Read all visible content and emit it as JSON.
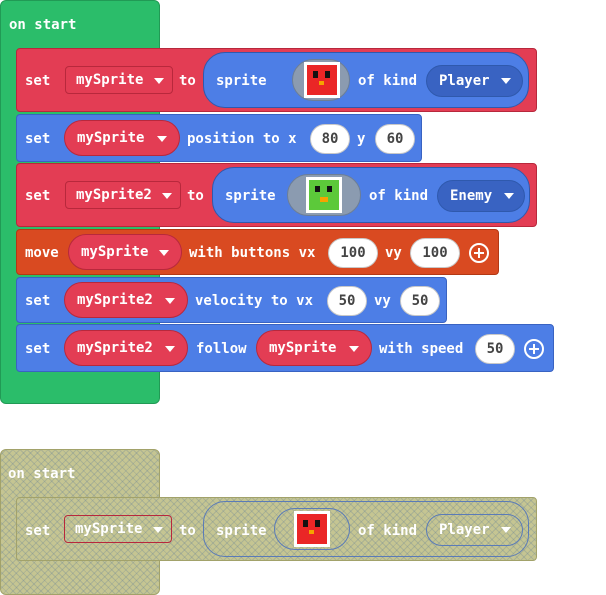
{
  "workspace": {
    "event_label": "on start",
    "blocks": {
      "b1": {
        "set": "set",
        "var": "mySprite",
        "to": "to",
        "sprite": "sprite",
        "of_kind": "of kind",
        "kind": "Player",
        "icon": "red-sprite-icon"
      },
      "b2": {
        "set": "set",
        "var": "mySprite",
        "position_to_x": "position to x",
        "x": "80",
        "y_label": "y",
        "y": "60"
      },
      "b3": {
        "set": "set",
        "var": "mySprite2",
        "to": "to",
        "sprite": "sprite",
        "of_kind": "of kind",
        "kind": "Enemy",
        "icon": "green-sprite-icon"
      },
      "b4": {
        "move": "move",
        "var": "mySprite",
        "with_buttons_vx": "with buttons vx",
        "vx": "100",
        "vy_label": "vy",
        "vy": "100"
      },
      "b5": {
        "set": "set",
        "var": "mySprite2",
        "velocity_to_vx": "velocity to vx",
        "vx": "50",
        "vy_label": "vy",
        "vy": "50"
      },
      "b6": {
        "set": "set",
        "var": "mySprite2",
        "follow": "follow",
        "target": "mySprite",
        "with_speed": "with speed",
        "speed": "50"
      }
    }
  },
  "disabled": {
    "event_label": "on start",
    "block": {
      "set": "set",
      "var": "mySprite",
      "to": "to",
      "sprite": "sprite",
      "of_kind": "of kind",
      "kind": "Player",
      "icon": "red-sprite-icon"
    }
  },
  "colors": {
    "event": "#2bbd6a",
    "variables": "#e33d54",
    "sprites": "#4d7ee6",
    "controller": "#d94a21"
  }
}
